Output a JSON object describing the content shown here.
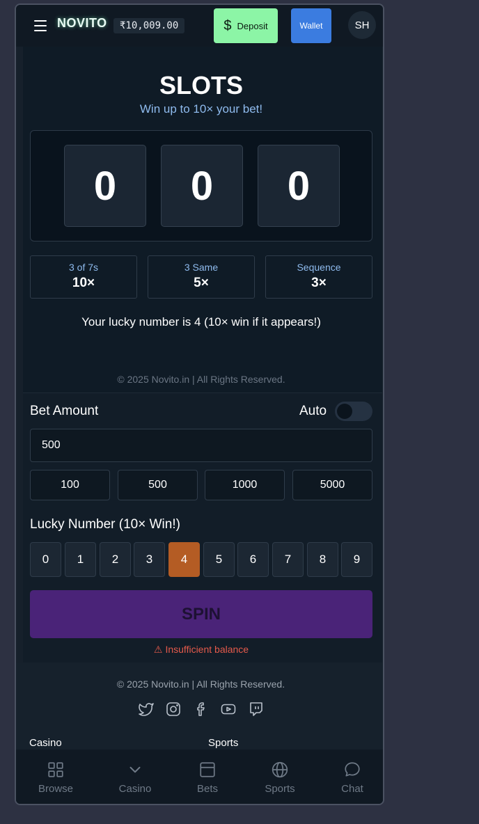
{
  "header": {
    "logo": "NOVITO",
    "balance": "₹10,009.00",
    "deposit_label": "Deposit",
    "deposit_icon": "$",
    "wallet_label": "Wallet",
    "avatar_initials": "SH"
  },
  "game": {
    "title": "SLOTS",
    "subtitle": "Win up to 10× your bet!",
    "reels": [
      "0",
      "0",
      "0"
    ],
    "payouts": [
      {
        "label": "3 of 7s",
        "value": "10×"
      },
      {
        "label": "3 Same",
        "value": "5×"
      },
      {
        "label": "Sequence",
        "value": "3×"
      }
    ],
    "lucky_message": "Your lucky number is 4 (10× win if it appears!)",
    "copyright": "© 2025 Novito.in | All Rights Reserved."
  },
  "controls": {
    "bet_label": "Bet Amount",
    "auto_label": "Auto",
    "auto_enabled": false,
    "bet_value": "500",
    "quick_bets": [
      "100",
      "500",
      "1000",
      "5000"
    ],
    "lucky_label": "Lucky Number (10× Win!)",
    "lucky_numbers": [
      "0",
      "1",
      "2",
      "3",
      "4",
      "5",
      "6",
      "7",
      "8",
      "9"
    ],
    "selected_lucky": "4",
    "spin_label": "SPIN",
    "error_icon": "⚠",
    "error_text": "Insufficient balance"
  },
  "footer": {
    "copyright": "© 2025 Novito.in | All Rights Reserved.",
    "social_icons": [
      "twitter-icon",
      "instagram-icon",
      "facebook-icon",
      "youtube-icon",
      "twitch-icon"
    ],
    "columns": [
      "Casino",
      "Sports"
    ]
  },
  "bottom_nav": [
    {
      "label": "Browse",
      "icon": "grid-icon"
    },
    {
      "label": "Casino",
      "icon": "chevron-down-icon"
    },
    {
      "label": "Bets",
      "icon": "bets-icon"
    },
    {
      "label": "Sports",
      "icon": "globe-icon"
    },
    {
      "label": "Chat",
      "icon": "chat-icon"
    }
  ],
  "colors": {
    "deposit": "#8cf5a6",
    "wallet": "#3b7ce0",
    "selected_number": "#b45c24",
    "spin": "#4a2378",
    "error": "#e55a4b",
    "accent_text": "#8fbbee"
  }
}
